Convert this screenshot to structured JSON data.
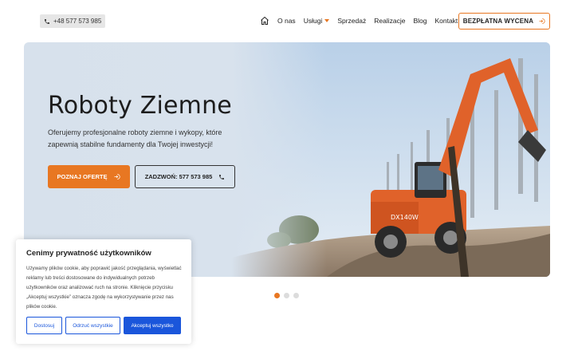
{
  "header": {
    "phone": "+48 577 573 985",
    "nav": [
      {
        "label": "O nas"
      },
      {
        "label": "Usługi"
      },
      {
        "label": "Sprzedaż"
      },
      {
        "label": "Realizacje"
      },
      {
        "label": "Blog"
      },
      {
        "label": "Kontakt"
      }
    ],
    "cta_label": "BEZPŁATNA WYCENA"
  },
  "hero": {
    "title": "Roboty Ziemne",
    "description": "Oferujemy profesjonalne roboty ziemne i wykopy, które zapewnią stabilne fundamenty dla Twojej inwestycji!",
    "primary_button": "POZNAJ OFERTĘ",
    "secondary_button": "ZADZWOŃ: 577 573 985"
  },
  "slider": {
    "total": 3,
    "active": 1
  },
  "cookie": {
    "title": "Cenimy prywatność użytkowników",
    "text": "Używamy plików cookie, aby poprawić jakość przeglądania, wyświetlać reklamy lub treści dostosowane do indywidualnych potrzeb użytkowników oraz analizować ruch na stronie. Kliknięcie przycisku „Akceptuj wszystkie” oznacza zgodę na wykorzystywanie przez nas plików cookie.",
    "buttons": {
      "customize": "Dostosuj",
      "reject": "Odrzuć wszystkie",
      "accept": "Akceptuj wszystko"
    }
  },
  "colors": {
    "accent": "#e87722",
    "cookie_blue": "#1a56db"
  }
}
